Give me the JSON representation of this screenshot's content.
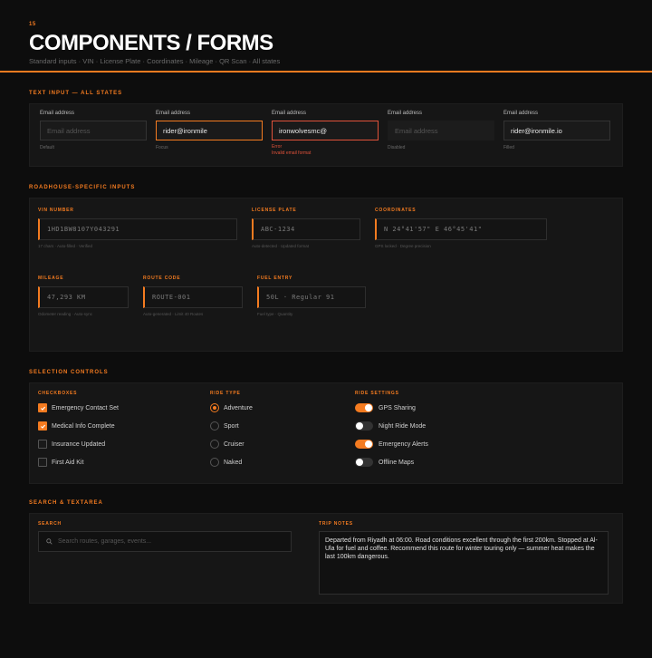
{
  "header": {
    "page_num": "15",
    "title": "COMPONENTS / FORMS",
    "subtitle": "Standard inputs · VIN · License Plate · Coordinates · Mileage · QR Scan · All states"
  },
  "text_input": {
    "section_title": "TEXT INPUT — ALL STATES",
    "field_label": "Email address",
    "states": [
      {
        "value": "Email address",
        "state": "Default"
      },
      {
        "value": "rider@ironmile",
        "state": "Focus"
      },
      {
        "value": "ironwolvesmc@",
        "state": "Error",
        "error_msg": "Invalid email format"
      },
      {
        "value": "Email address",
        "state": "Disabled"
      },
      {
        "value": "rider@ironmile.io",
        "state": "Filled"
      }
    ]
  },
  "roadhouse": {
    "section_title": "ROADHOUSE-SPECIFIC INPUTS",
    "vin": {
      "label": "VIN NUMBER",
      "value": "1HD1BW8107Y043291",
      "helper": "17 chars · Auto-filled · Verified"
    },
    "plate": {
      "label": "LICENSE PLATE",
      "value": "ABC-1234",
      "helper": "Auto-detected · Updated format"
    },
    "coords": {
      "label": "COORDINATES",
      "value": "N 24°41'57\" E 46°45'41\"",
      "helper": "GPS locked · Degree precision"
    },
    "mileage": {
      "label": "MILEAGE",
      "value": "47,293 KM",
      "helper": "Odometer reading · Auto-sync"
    },
    "route": {
      "label": "ROUTE CODE",
      "value": "ROUTE-001",
      "helper": "Auto-generated · Limit 40 Routes"
    },
    "fuel": {
      "label": "FUEL ENTRY",
      "value": "50L · Regular 91",
      "helper": "Fuel type · Quantity"
    }
  },
  "selection": {
    "section_title": "SELECTION CONTROLS",
    "checkboxes_label": "CHECKBOXES",
    "checkboxes": [
      {
        "label": "Emergency Contact Set",
        "checked": true
      },
      {
        "label": "Medical Info Complete",
        "checked": true
      },
      {
        "label": "Insurance Updated",
        "checked": false
      },
      {
        "label": "First Aid Kit",
        "checked": false
      }
    ],
    "ride_type_label": "RIDE TYPE",
    "ride_types": [
      {
        "label": "Adventure",
        "selected": true
      },
      {
        "label": "Sport",
        "selected": false
      },
      {
        "label": "Cruiser",
        "selected": false
      },
      {
        "label": "Naked",
        "selected": false
      }
    ],
    "ride_settings_label": "RIDE SETTINGS",
    "toggles": [
      {
        "label": "GPS Sharing",
        "on": true
      },
      {
        "label": "Night Ride Mode",
        "on": false
      },
      {
        "label": "Emergency Alerts",
        "on": true
      },
      {
        "label": "Offline Maps",
        "on": false
      }
    ]
  },
  "search_section": {
    "section_title": "SEARCH & TEXTAREA",
    "search_label": "SEARCH",
    "search_placeholder": "Search routes, garages, events...",
    "notes_label": "TRIP NOTES",
    "notes_value": "Departed from Riyadh at 06:00. Road conditions excellent through the first 200km. Stopped at Al-Ula for fuel and coffee. Recommend this route for winter touring only — summer heat makes the last 100km dangerous."
  },
  "colors": {
    "accent": "#f47b20",
    "error": "#e0523a",
    "background": "#0d0d0d",
    "panel": "#161616"
  }
}
